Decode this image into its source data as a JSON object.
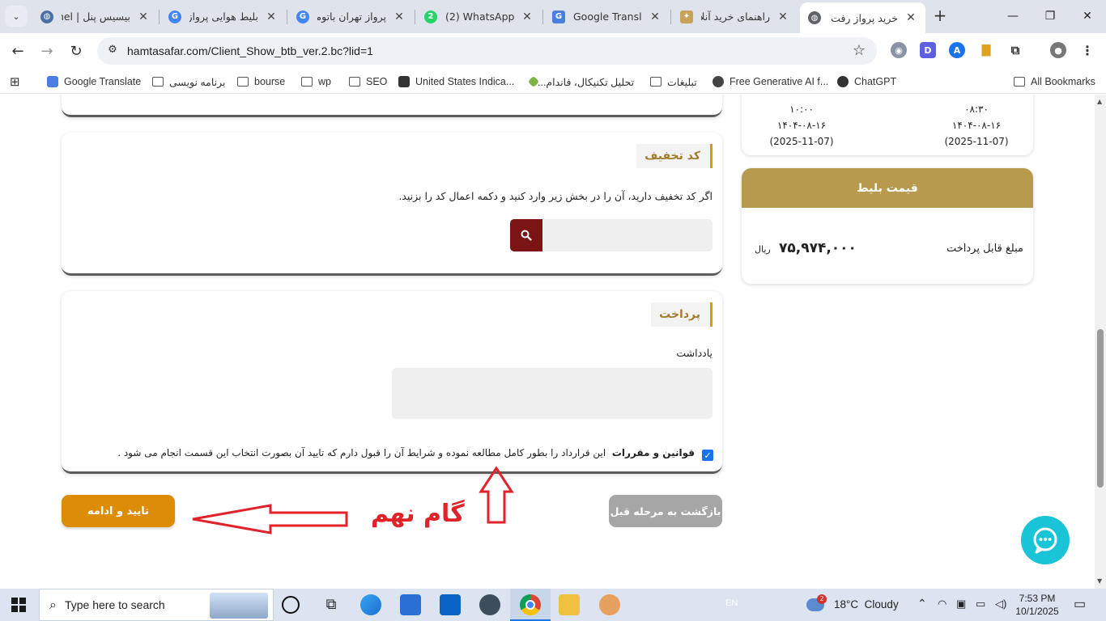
{
  "browser": {
    "tabs": [
      {
        "title": "بیسیس پنل | anel",
        "active": false
      },
      {
        "title": "بلیط هوایی پرواز",
        "active": false
      },
      {
        "title": "پرواز تهران باتومی",
        "active": false
      },
      {
        "title": "(2) WhatsApp",
        "active": false
      },
      {
        "title": "Google Translate",
        "active": false
      },
      {
        "title": "راهنمای خرید آنلاین",
        "active": false
      },
      {
        "title": "خرید پرواز رفت و",
        "active": true
      }
    ],
    "new_tab_label": "+",
    "url": "hamtasafar.com/Client_Show_btb_ver.2.bc?lid=1",
    "bookmarks": [
      {
        "label": "Google Translate"
      },
      {
        "label": "برنامه نویسی"
      },
      {
        "label": "bourse"
      },
      {
        "label": "wp"
      },
      {
        "label": "SEO"
      },
      {
        "label": "United States Indica..."
      },
      {
        "label": "تحلیل تکنیکال، فاندام..."
      },
      {
        "label": "تبلیغات"
      },
      {
        "label": "Free Generative AI f..."
      },
      {
        "label": "ChatGPT"
      }
    ],
    "all_bookmarks": "All Bookmarks"
  },
  "flight": {
    "arrive": {
      "time": "۱۰:۰۰",
      "date_fa": "۱۴۰۴-۰۸-۱۶",
      "date_en": "(2025-11-07)"
    },
    "depart": {
      "time": "۰۸:۳۰",
      "date_fa": "۱۴۰۴-۰۸-۱۶",
      "date_en": "(2025-11-07)"
    }
  },
  "discount": {
    "title": "کد تخفیف",
    "desc": "اگر کد تخفیف دارید، آن را در بخش زیر وارد کنید و دکمه اعمال کد را بزنید.",
    "input_value": ""
  },
  "payment": {
    "title": "پرداخت",
    "note_label": "یادداشت",
    "note_value": "",
    "terms_bold": "قوانین و مقررات",
    "terms_text": "این قرارداد را بطور کامل مطالعه نموده و شرایط آن را قبول دارم که تایید آن بصورت انتخاب این قسمت انجام می شود ."
  },
  "price": {
    "title": "قیمت بلیط",
    "label": "مبلغ قابل پرداخت",
    "amount": "۷۵,۹۷۴,۰۰۰",
    "currency": "ریال"
  },
  "buttons": {
    "confirm": "تایید و ادامه",
    "back": "بازگشت به مرحله قبل"
  },
  "annotation": {
    "step_label": "گام نهم"
  },
  "taskbar": {
    "search_placeholder": "Type here to search",
    "lang": "EN",
    "weather": "18°C  Cloudy",
    "weather_badge": "2",
    "time": "7:53 PM",
    "date": "10/1/2025"
  },
  "colors": {
    "accent_gold": "#b89a4e",
    "confirm_orange": "#dc8c06",
    "search_btn": "#7b1515",
    "chat": "#18c4d6",
    "annotation_red": "#e0222a"
  }
}
